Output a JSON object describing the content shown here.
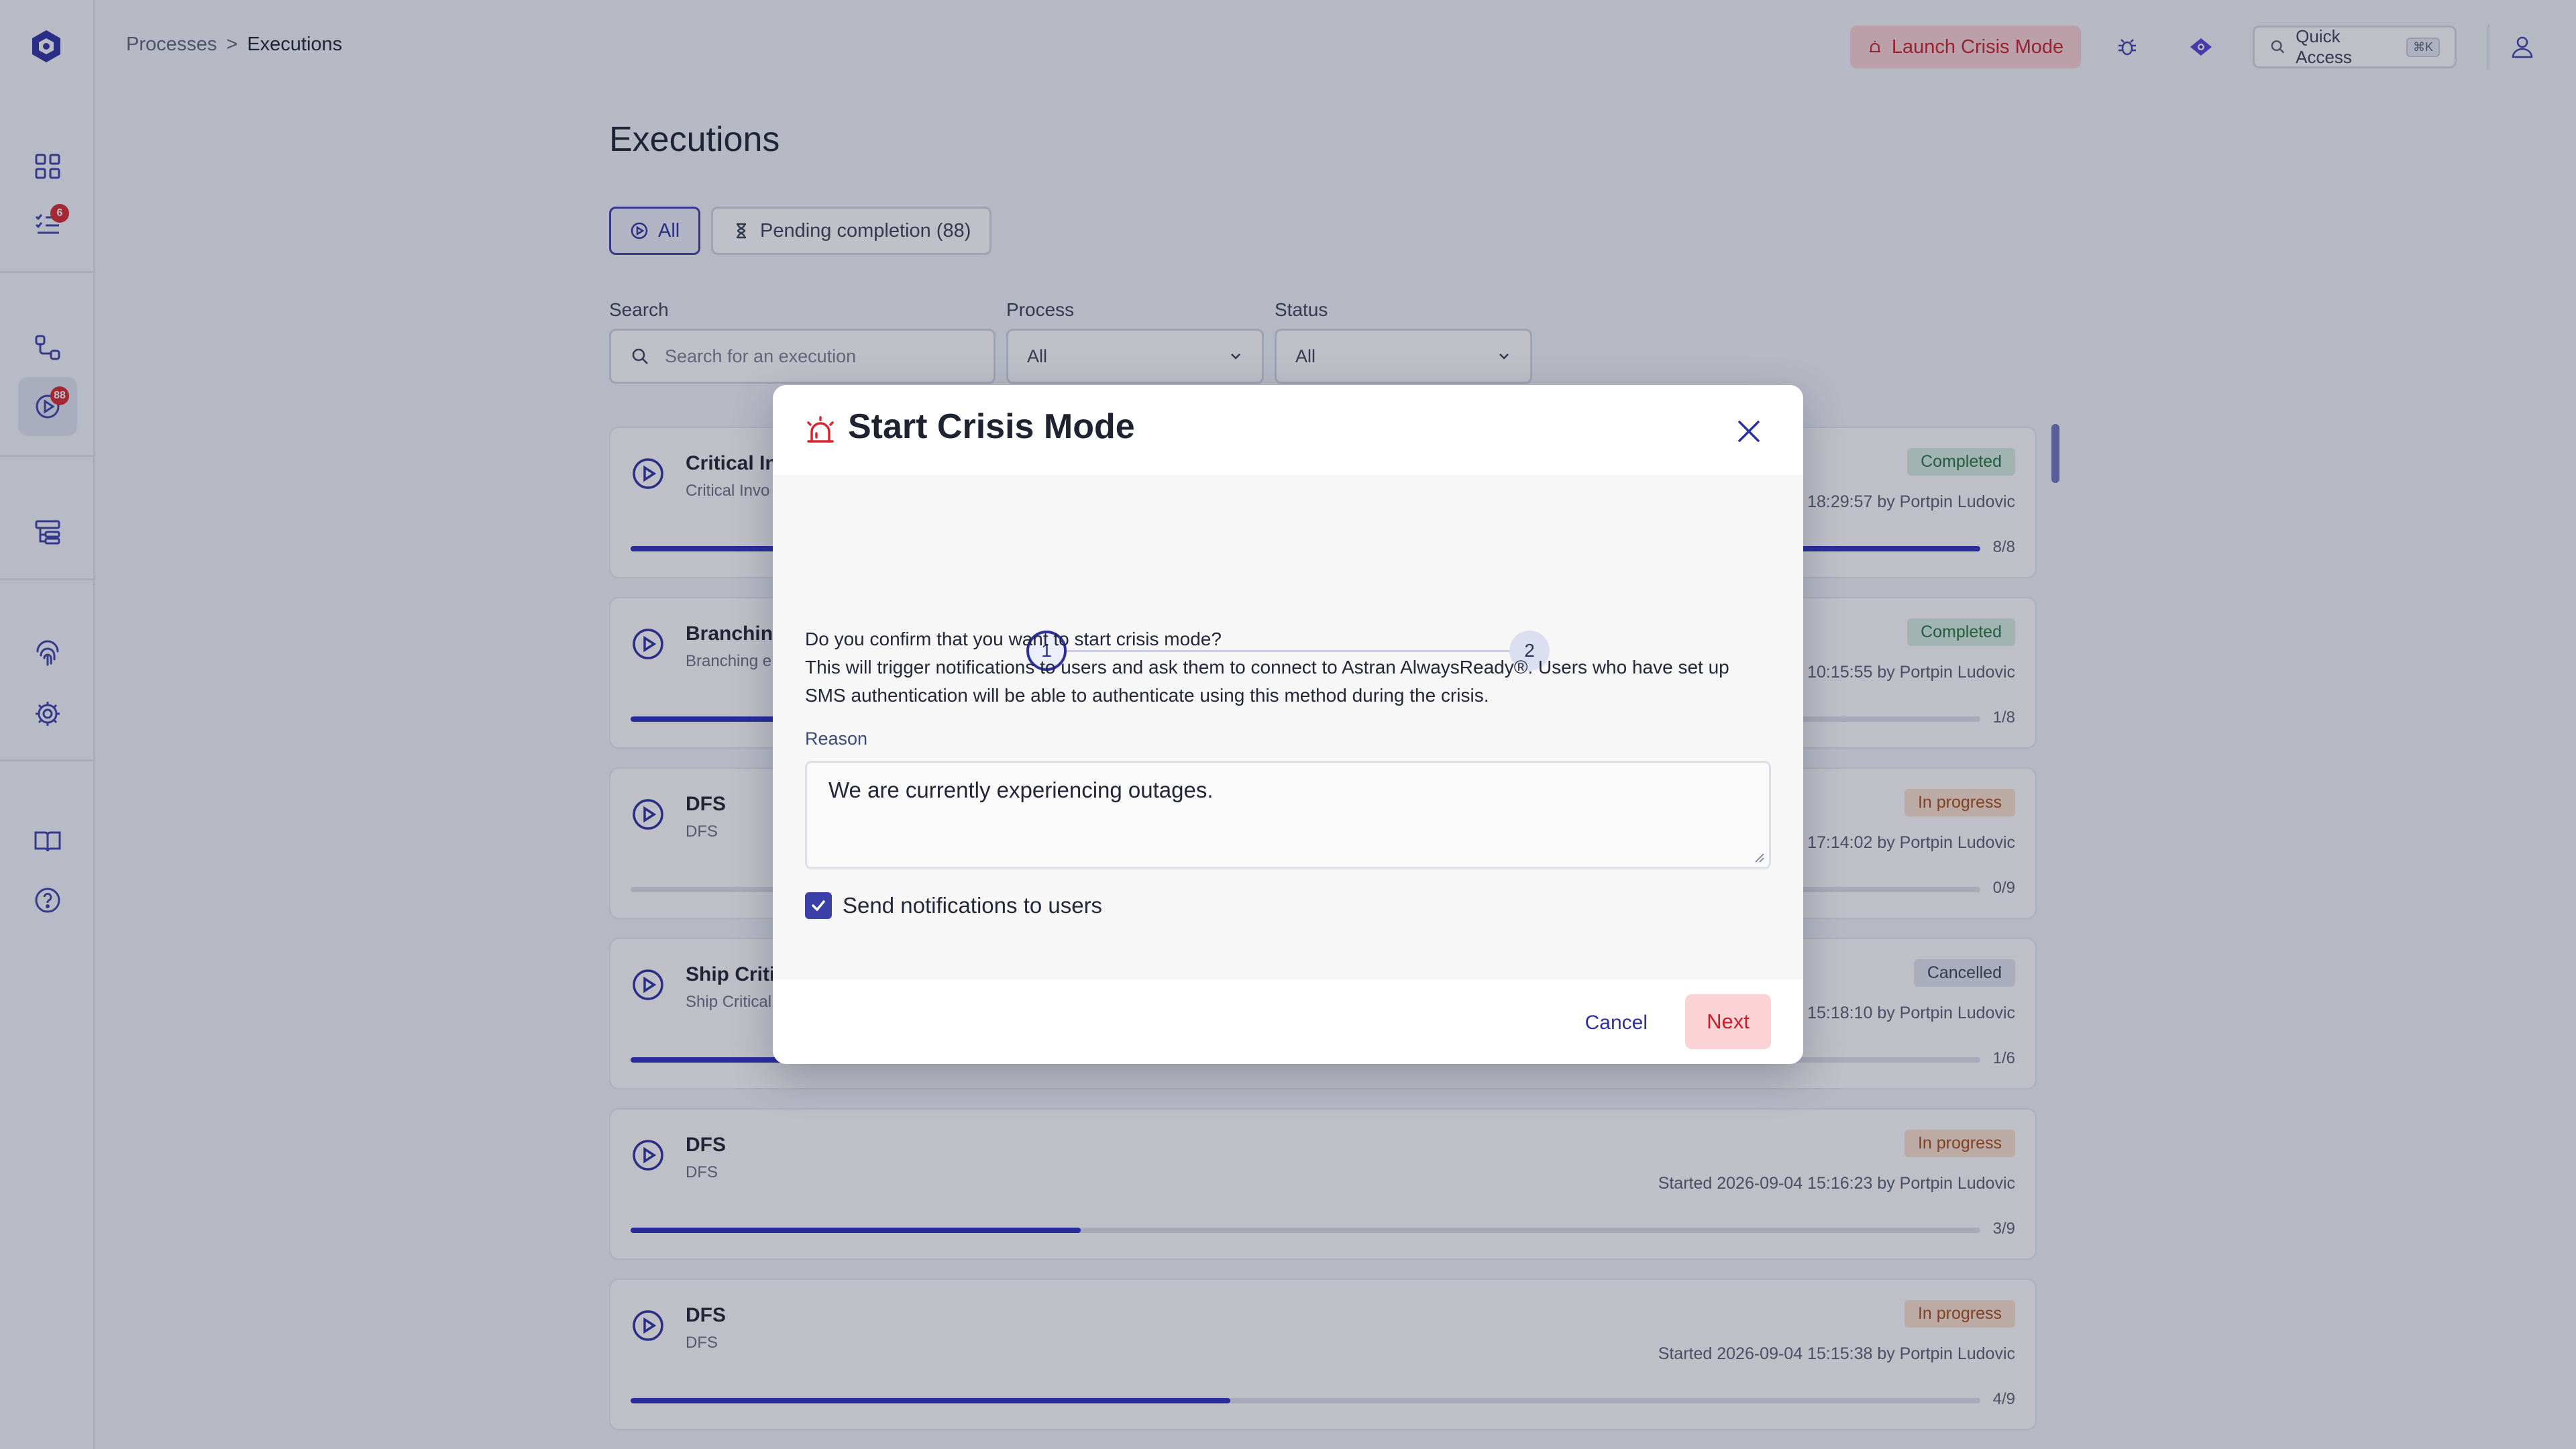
{
  "breadcrumb": {
    "parent": "Processes",
    "separator": ">",
    "current": "Executions"
  },
  "topbar": {
    "crisis_label": "Launch Crisis Mode",
    "quick_access_label": "Quick Access",
    "quick_access_shortcut": "⌘K"
  },
  "sidebar": {
    "tasks_badge": "6",
    "executions_badge": "88"
  },
  "page": {
    "title": "Executions",
    "tabs": [
      {
        "label": "All"
      },
      {
        "label": "Pending completion (88)"
      }
    ],
    "filters": {
      "search_label": "Search",
      "search_placeholder": "Search for an execution",
      "process_label": "Process",
      "process_value": "All",
      "status_label": "Status",
      "status_value": "All"
    }
  },
  "executions": [
    {
      "title": "Critical In",
      "subtitle": "Critical Invo",
      "status": "Completed",
      "started": "18:29:57 by Portpin Ludovic",
      "ratio": "8/8",
      "progress": 1.0
    },
    {
      "title": "Branching",
      "subtitle": "Branching e",
      "status": "Completed",
      "started": "10:15:55 by Portpin Ludovic",
      "ratio": "1/8",
      "progress": 0.125
    },
    {
      "title": "DFS",
      "subtitle": "DFS",
      "status": "In progress",
      "started": "17:14:02 by Portpin Ludovic",
      "ratio": "0/9",
      "progress": 0
    },
    {
      "title": "Ship Critic",
      "subtitle": "Ship Critical",
      "status": "Cancelled",
      "started": "15:18:10 by Portpin Ludovic",
      "ratio": "1/6",
      "progress": 0.1667
    },
    {
      "title": "DFS",
      "subtitle": "DFS",
      "status": "In progress",
      "started": "Started 2026-09-04 15:16:23 by Portpin Ludovic",
      "ratio": "3/9",
      "progress": 0.3333
    },
    {
      "title": "DFS",
      "subtitle": "DFS",
      "status": "In progress",
      "started": "Started 2026-09-04 15:15:38 by Portpin Ludovic",
      "ratio": "4/9",
      "progress": 0.4444
    }
  ],
  "modal": {
    "title": "Start Crisis Mode",
    "steps": [
      "1",
      "2"
    ],
    "current_step": 1,
    "question": "Do you confirm that you want to start crisis mode?",
    "description": "This will trigger notifications to users and ask them to connect to Astran AlwaysReady®. Users who have set up SMS authentication will be able to authenticate using this method during the crisis.",
    "reason_label": "Reason",
    "reason_value": "We are currently experiencing outages.",
    "notify_label": "Send notifications to users",
    "notify_checked": true,
    "cancel_label": "Cancel",
    "next_label": "Next"
  },
  "colors": {
    "accent": "#2c30a0",
    "danger": "#c62029",
    "danger_bg": "#fbd3d6"
  }
}
